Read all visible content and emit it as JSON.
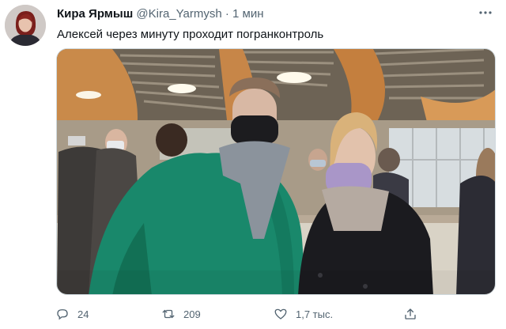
{
  "tweet": {
    "display_name": "Кира Ярмыш",
    "handle": "@Kira_Yarmysh",
    "separator": "·",
    "time": "1 мин",
    "text": "Алексей через минуту проходит погранконтроль"
  },
  "actions": {
    "reply_count": "24",
    "retweet_count": "209",
    "like_count": "1,7 тыс."
  },
  "icons": {
    "reply": "speech-bubble-icon",
    "retweet": "retweet-arrows-icon",
    "like": "heart-icon",
    "share": "share-upload-icon",
    "more": "more-dots-icon"
  }
}
